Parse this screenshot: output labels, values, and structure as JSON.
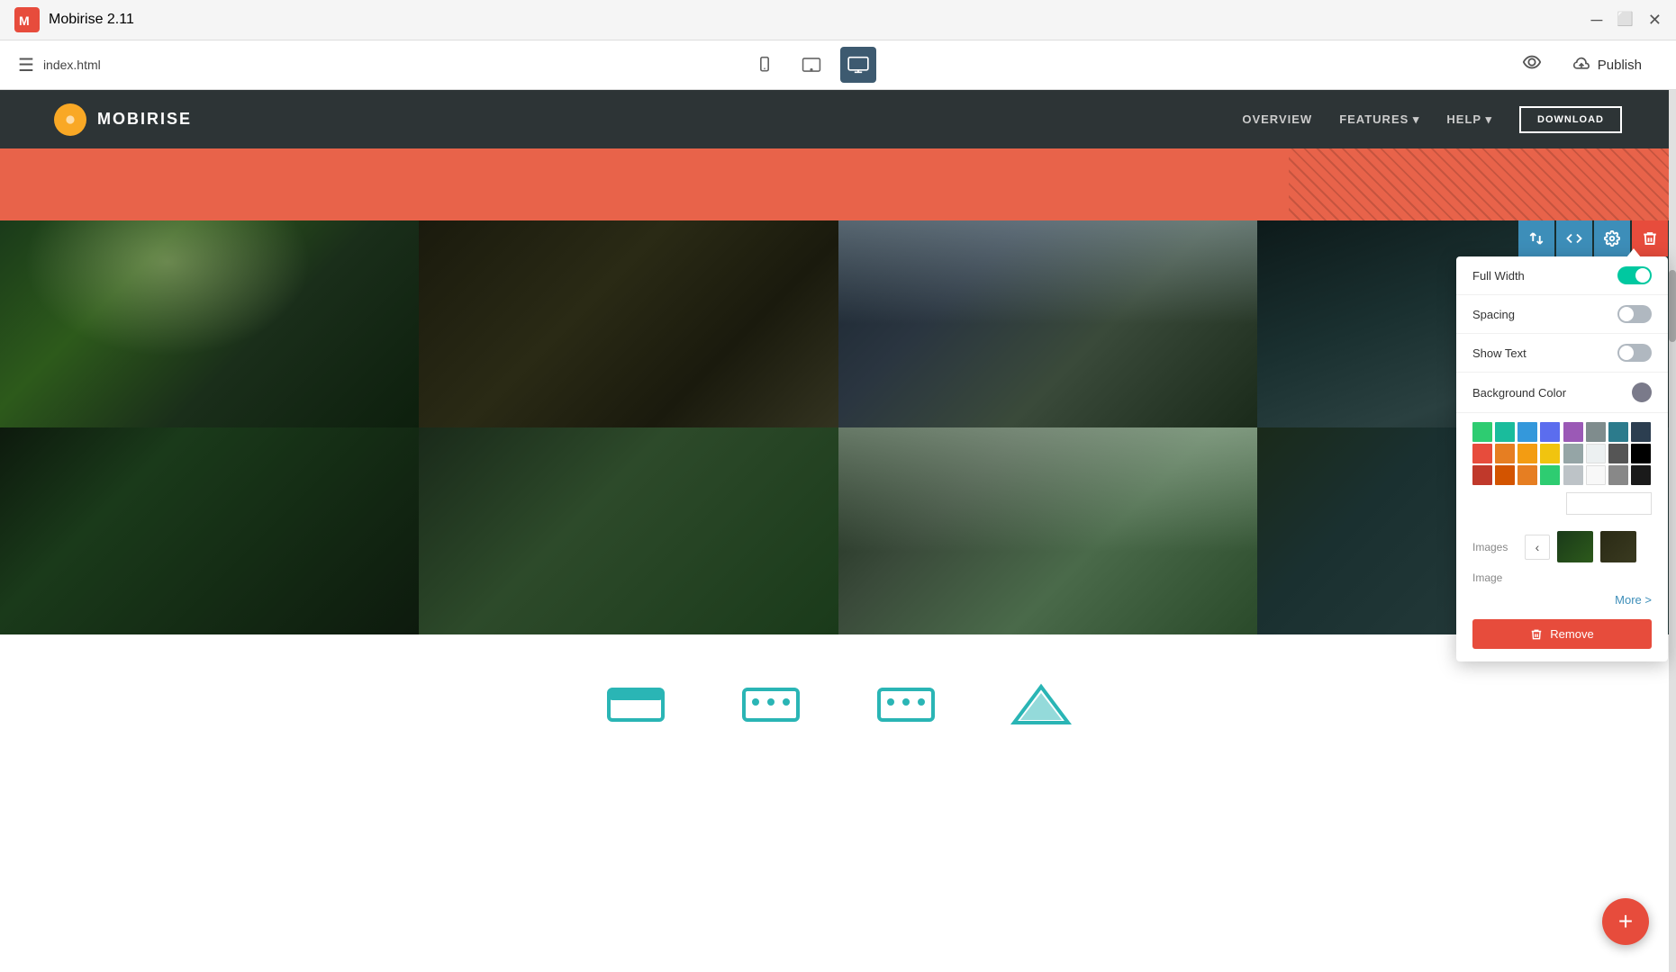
{
  "titlebar": {
    "app_name": "Mobirise 2.11",
    "filename": "index.html",
    "minimize_label": "minimize",
    "maximize_label": "maximize",
    "close_label": "close"
  },
  "toolbar": {
    "filename": "index.html",
    "device_mobile_label": "mobile",
    "device_tablet_label": "tablet",
    "device_desktop_label": "desktop",
    "preview_label": "preview",
    "publish_label": "Publish"
  },
  "site_nav": {
    "logo_text": "MOBIRISE",
    "nav_items": [
      "OVERVIEW",
      "FEATURES",
      "HELP",
      "DOWNLOAD"
    ],
    "download_btn": "DOWNLOAD"
  },
  "block_toolbar": {
    "swap_label": "swap",
    "code_label": "code",
    "settings_label": "settings",
    "delete_label": "delete"
  },
  "settings_panel": {
    "full_width_label": "Full Width",
    "full_width_on": true,
    "spacing_label": "Spacing",
    "spacing_on": false,
    "show_text_label": "Show Text",
    "show_text_on": false,
    "background_color_label": "Background Color",
    "images_label": "Images",
    "image_label": "Image",
    "more_label": "More >",
    "remove_label": "Remove",
    "hex_color": "#553982"
  },
  "color_palette": {
    "colors": [
      "#2ecc71",
      "#1abc9c",
      "#3498db",
      "#2980b9",
      "#9b59b6",
      "#2c3e50",
      "#27ae60",
      "#16a085",
      "#e74c3c",
      "#e67e22",
      "#f39c12",
      "#f1c40f",
      "#95a5a6",
      "#7f8c8d",
      "#2c3e50",
      "#1a252f",
      "#c0392b",
      "#d35400",
      "#e67e22",
      "#2ecc71",
      "#bdc3c7",
      "#ecf0f1",
      "#1a1a1a",
      "#000000"
    ]
  },
  "icons_section": {
    "icons": [
      "▬",
      "⬛",
      "▬"
    ]
  },
  "fab": {
    "label": "+"
  }
}
